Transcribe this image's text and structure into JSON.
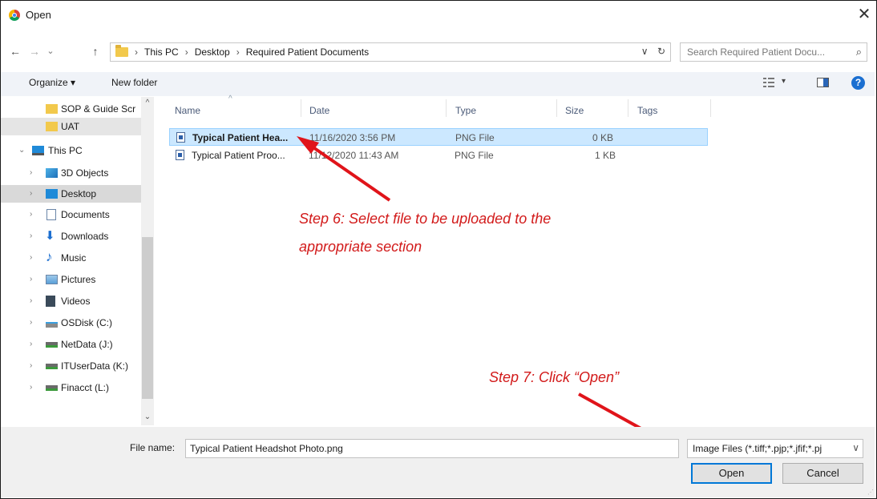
{
  "window": {
    "title": "Open",
    "close_glyph": "✕"
  },
  "nav": {
    "back": "←",
    "forward": "→",
    "recent": "⌄",
    "up": "↑"
  },
  "address": {
    "crumbs": [
      "This PC",
      "Desktop",
      "Required Patient Documents"
    ],
    "separator": "›",
    "dropdown_glyph": "∨",
    "refresh_glyph": "↻"
  },
  "search": {
    "placeholder": "Search Required Patient Docu...",
    "icon": "⌕"
  },
  "toolbar": {
    "organize_label": "Organize ▾",
    "new_folder_label": "New folder",
    "view_glyph": "▾",
    "help_glyph": "?"
  },
  "sidebar": {
    "items": [
      {
        "label": "SOP & Guide Scr",
        "icon": "folder-icon",
        "expandable": false
      },
      {
        "label": "UAT",
        "icon": "folder-icon",
        "expandable": false
      },
      {
        "label": "This PC",
        "icon": "pc-icon",
        "expandable": true,
        "expanded": true
      },
      {
        "label": "3D Objects",
        "icon": "cube-icon",
        "expandable": true
      },
      {
        "label": "Desktop",
        "icon": "desktop-icon",
        "expandable": true
      },
      {
        "label": "Documents",
        "icon": "document-icon",
        "expandable": true
      },
      {
        "label": "Downloads",
        "icon": "download-icon",
        "expandable": true
      },
      {
        "label": "Music",
        "icon": "music-icon",
        "expandable": true
      },
      {
        "label": "Pictures",
        "icon": "pictures-icon",
        "expandable": true
      },
      {
        "label": "Videos",
        "icon": "videos-icon",
        "expandable": true
      },
      {
        "label": "OSDisk (C:)",
        "icon": "disk-icon",
        "expandable": true
      },
      {
        "label": "NetData (J:)",
        "icon": "network-drive-icon",
        "expandable": true
      },
      {
        "label": "ITUserData (K:)",
        "icon": "network-drive-icon",
        "expandable": true
      },
      {
        "label": "Finacct (L:)",
        "icon": "network-drive-icon",
        "expandable": true
      }
    ],
    "scroll_up_glyph": "^",
    "scroll_down_glyph": "⌄"
  },
  "columns": {
    "name": "Name",
    "date": "Date",
    "type": "Type",
    "size": "Size",
    "tags": "Tags"
  },
  "files": [
    {
      "name": "Typical Patient Hea...",
      "date": "11/16/2020 3:56 PM",
      "type": "PNG File",
      "size": "0 KB",
      "selected": true
    },
    {
      "name": "Typical Patient Proo...",
      "date": "11/12/2020 11:43 AM",
      "type": "PNG File",
      "size": "1 KB",
      "selected": false
    }
  ],
  "annotations": {
    "step6_line1": "Step 6: Select file to be uploaded to the",
    "step6_line2": "appropriate section",
    "step7": "Step 7: Click “Open”",
    "arrow_color": "#e0141a"
  },
  "footer": {
    "file_name_label": "File name:",
    "file_name_value": "Typical Patient Headshot Photo.png",
    "filter_value": "Image Files (*.tiff;*.pjp;*.jfif;*.pj",
    "filter_chevron": "∨",
    "open_label": "Open",
    "cancel_label": "Cancel"
  },
  "colors": {
    "accent": "#0078d7",
    "selection": "#cce8ff",
    "annotation": "#d21a1a"
  }
}
